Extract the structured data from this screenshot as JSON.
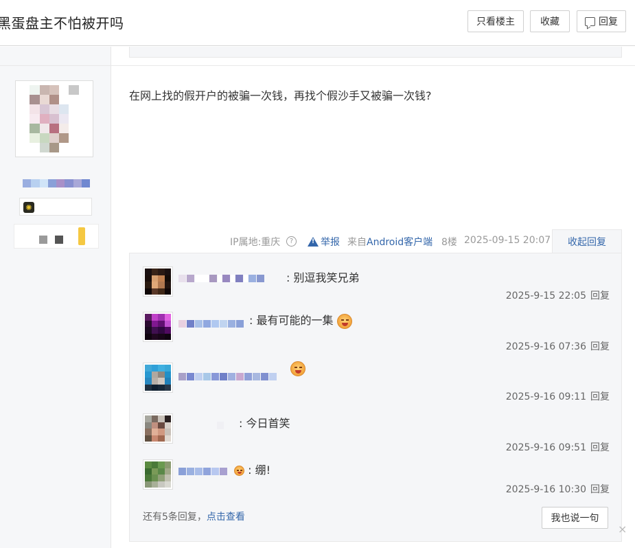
{
  "header": {
    "title": "黑蛋盘主不怕被开吗",
    "only_author": "只看楼主",
    "favorite": "收藏",
    "reply": "回复"
  },
  "post": {
    "content": "在网上找的假开户的被骗一次钱，再找个假沙手又被骗一次钱?",
    "ip": "IP属地:重庆",
    "help": "?",
    "report": "举报",
    "from_prefix": "来自",
    "from_app": "Android客户端",
    "floor": "8楼",
    "time": "2025-09-15 20:07",
    "collapse": "收起回复"
  },
  "replies": [
    {
      "text": ": 别逗我笑兄弟",
      "time": "2025-9-15 22:05",
      "reply_label": "回复"
    },
    {
      "text": ": 最有可能的一集",
      "time": "2025-9-16 07:36",
      "reply_label": "回复"
    },
    {
      "text": "",
      "time": "2025-9-16 09:11",
      "reply_label": "回复"
    },
    {
      "text": ": 今日首笑",
      "time": "2025-9-16 09:51",
      "reply_label": "回复"
    },
    {
      "text": ": 绷!",
      "time": "2025-9-16 10:30",
      "reply_label": "回复"
    }
  ],
  "more": {
    "prefix": "还有5条回复，",
    "link": "点击查看"
  },
  "say_button": "我也说一句",
  "close": "×",
  "icons": {
    "reply_icon": "comment-icon",
    "report_icon": "warning-icon",
    "help_icon": "question-icon",
    "badge_icon": "sun-badge-icon",
    "emoji": "laughing-face-icon"
  },
  "colors": {
    "link": "#3366aa",
    "panel": "#f5f6f8"
  }
}
